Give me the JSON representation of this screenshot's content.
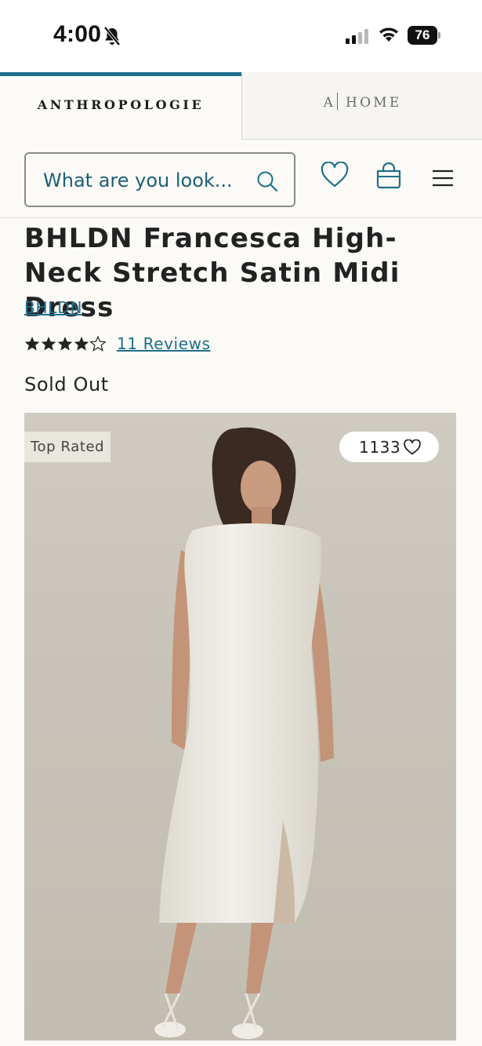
{
  "status_bar": {
    "time": "4:00",
    "battery": "76"
  },
  "brand_tabs": {
    "active": "ANTHROPOLOGIE",
    "home_prefix": "A",
    "home_label": "HOME"
  },
  "header": {
    "search_placeholder": "What are you look..."
  },
  "product": {
    "title": "BHLDN Francesca High-Neck Stretch Satin Midi Dress",
    "brand": "BHLDN",
    "rating": 4.5,
    "reviews_label": "11 Reviews",
    "availability": "Sold Out",
    "badge": "Top Rated",
    "likes": "1133"
  },
  "colors": {
    "accent": "#1f6f8b",
    "text": "#222222",
    "background": "#fbfaf6"
  }
}
